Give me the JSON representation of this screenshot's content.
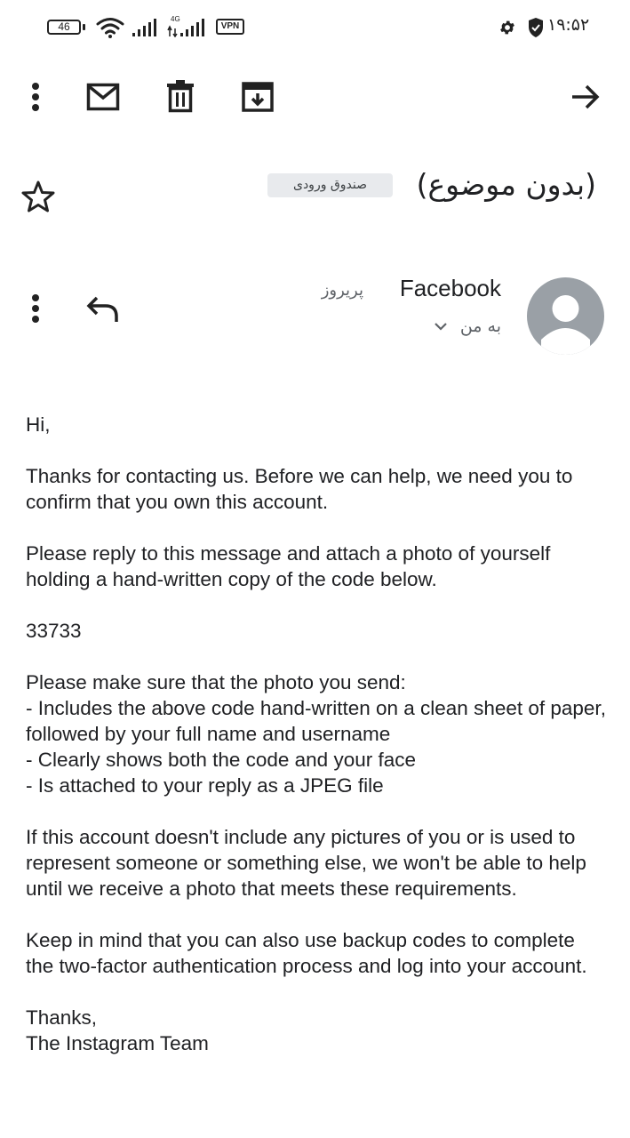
{
  "status_bar": {
    "battery": "46",
    "network_type": "4G",
    "vpn": "VPN",
    "time": "۱۹:۵۲"
  },
  "toolbar": {
    "icons": [
      "more-vert-icon",
      "mail-icon",
      "delete-icon",
      "archive-icon",
      "arrow-forward-icon"
    ]
  },
  "email": {
    "subject": "(بدون موضوع)",
    "label": "صندوق ورودی",
    "sender_name": "Facebook",
    "date": "پریروز",
    "recipient": "به من",
    "body": [
      "Hi,",
      "Thanks for contacting us. Before we can help, we need you to confirm that you own this account.",
      "Please reply to this message and attach a photo of yourself holding a hand-written copy of the code below.",
      "33733",
      "Please make sure that the photo you send:\n- Includes the above code hand-written on a clean sheet of paper, followed by your full name and username\n- Clearly shows both the code and your face\n- Is attached to your reply as a JPEG file",
      "If this account doesn't include any pictures of you or is used to represent someone or something else, we won't be able to help until we receive a photo that meets these requirements.",
      "Keep in mind that you can also use backup codes to complete the two-factor authentication process and log into your account.",
      "Thanks,\nThe Instagram Team"
    ]
  }
}
